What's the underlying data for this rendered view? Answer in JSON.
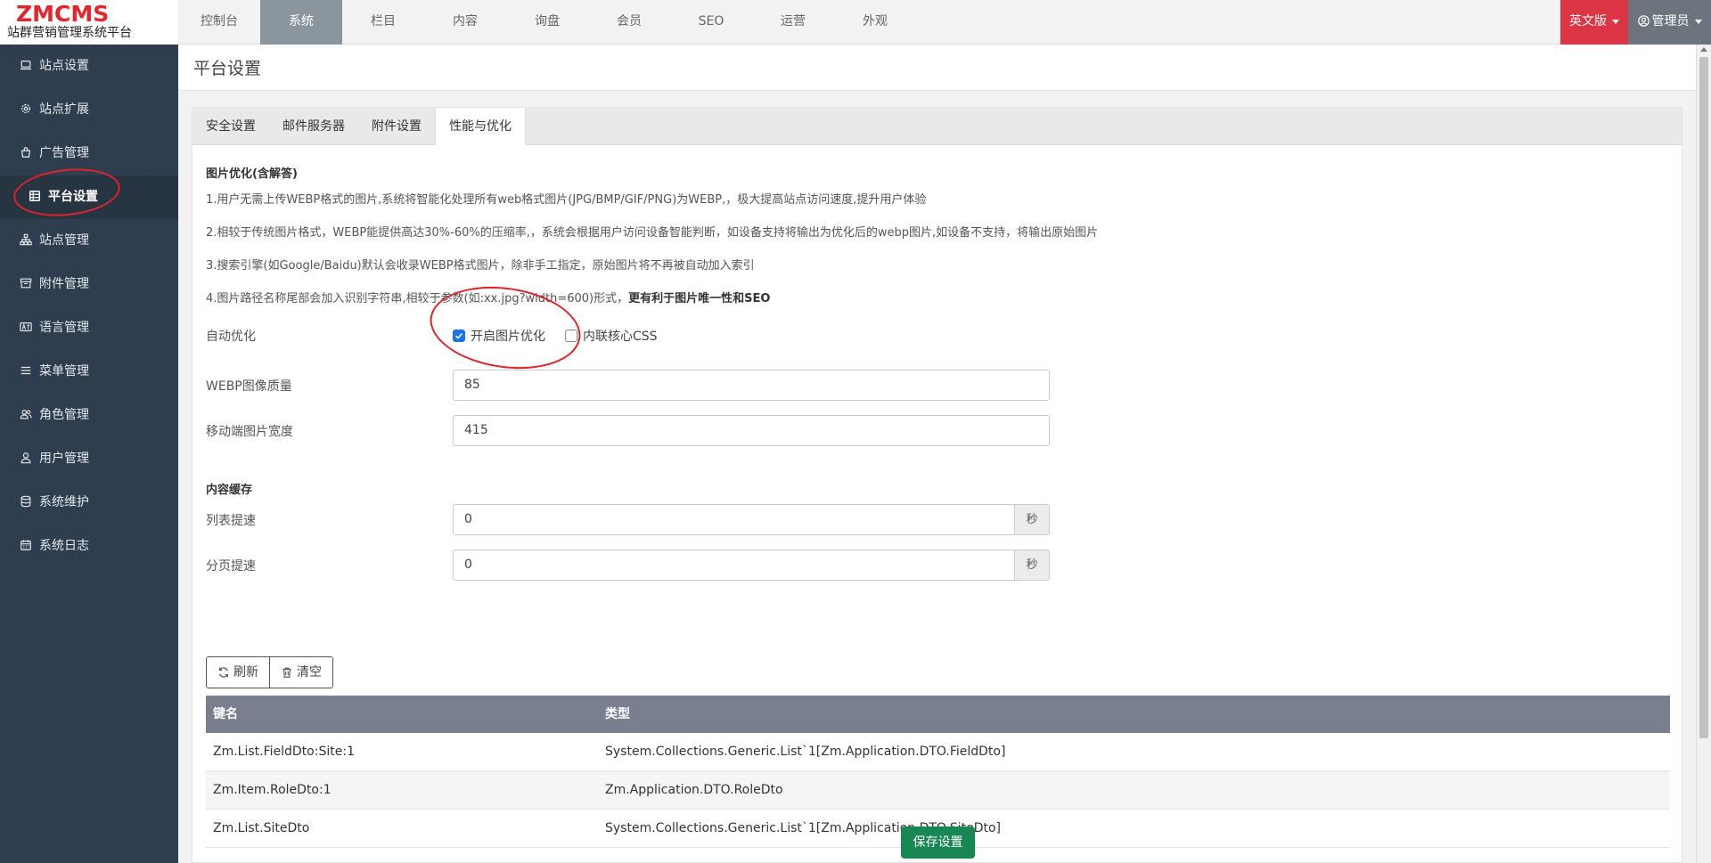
{
  "logo": {
    "mark": "ZMCMS",
    "subtitle": "站群营销管理系统平台"
  },
  "topnav": [
    "控制台",
    "系统",
    "栏目",
    "内容",
    "询盘",
    "会员",
    "SEO",
    "运营",
    "外观"
  ],
  "header": {
    "lang": "英文版",
    "admin": "管理员"
  },
  "sidebar": [
    {
      "label": "站点设置",
      "icon": "laptop-icon"
    },
    {
      "label": "站点扩展",
      "icon": "gear-icon"
    },
    {
      "label": "广告管理",
      "icon": "bag-icon"
    },
    {
      "label": "平台设置",
      "icon": "list-icon"
    },
    {
      "label": "站点管理",
      "icon": "sitemap-icon"
    },
    {
      "label": "附件管理",
      "icon": "archive-icon"
    },
    {
      "label": "语言管理",
      "icon": "language-icon"
    },
    {
      "label": "菜单管理",
      "icon": "menu-icon"
    },
    {
      "label": "角色管理",
      "icon": "users-icon"
    },
    {
      "label": "用户管理",
      "icon": "user-icon"
    },
    {
      "label": "系统维护",
      "icon": "database-icon"
    },
    {
      "label": "系统日志",
      "icon": "calendar-icon"
    }
  ],
  "page": {
    "title": "平台设置"
  },
  "tabs": [
    "安全设置",
    "邮件服务器",
    "附件设置",
    "性能与优化"
  ],
  "image_opt": {
    "title": "图片优化(含解答)",
    "tip1": "1.用户无需上传WEBP格式的图片,系统将智能化处理所有web格式图片(JPG/BMP/GIF/PNG)为WEBP,，极大提高站点访问速度,提升用户体验",
    "tip2": "2.相较于传统图片格式，WEBP能提供高达30%-60%的压缩率,，系统会根据用户访问设备智能判断，如设备支持将输出为优化后的webp图片,如设备不支持，将输出原始图片",
    "tip3": "3.搜索引擎(如Google/Baidu)默认会收录WEBP格式图片，除非手工指定，原始图片将不再被自动加入索引",
    "tip4_prefix": "4.图片路径名称尾部会加入识别字符串,相较于参数(如:xx.jpg?width=600)形式，",
    "tip4_bold": "更有利于图片唯一性和SEO",
    "auto_label": "自动优化",
    "opt_enable": "开启图片优化",
    "opt_enable_checked": true,
    "opt_css": "内联核心CSS",
    "opt_css_checked": false,
    "webp_label": "WEBP图像质量",
    "webp_value": "85",
    "mobile_label": "移动端图片宽度",
    "mobile_value": "415"
  },
  "cache": {
    "title": "内容缓存",
    "list_label": "列表提速",
    "list_value": "0",
    "page_label": "分页提速",
    "page_value": "0",
    "unit": "秒",
    "refresh": "刷新",
    "clear": "清空",
    "col_key": "键名",
    "col_type": "类型",
    "rows": [
      {
        "key": "Zm.List.FieldDto:Site:1",
        "type": "System.Collections.Generic.List`1[Zm.Application.DTO.FieldDto]"
      },
      {
        "key": "Zm.Item.RoleDto:1",
        "type": "Zm.Application.DTO.RoleDto"
      },
      {
        "key": "Zm.List.SiteDto",
        "type": "System.Collections.Generic.List`1[Zm.Application.DTO.SiteDto]"
      }
    ]
  },
  "save": "保存设置",
  "colors": {
    "sidebar": "#2f3e4e",
    "danger": "#dc3545",
    "success": "#198754",
    "annotation": "#e0232a"
  }
}
